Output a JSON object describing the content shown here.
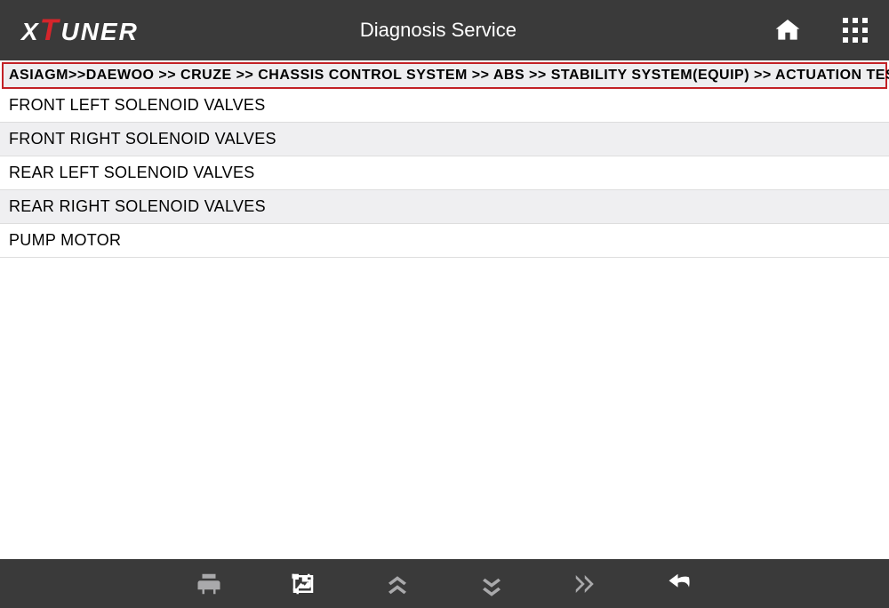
{
  "header": {
    "logo_text": "XTUNER",
    "title": "Diagnosis Service"
  },
  "breadcrumb": "ASIAGM>>DAEWOO >> CRUZE >> CHASSIS CONTROL SYSTEM >> ABS >> STABILITY SYSTEM(EQUIP) >> ACTUATION TEST",
  "list_items": [
    "FRONT LEFT SOLENOID VALVES",
    "FRONT RIGHT SOLENOID VALVES",
    "REAR LEFT SOLENOID VALVES",
    "REAR RIGHT SOLENOID VALVES",
    "PUMP MOTOR"
  ],
  "icons": {
    "home": "home-icon",
    "menu": "grid-menu-icon",
    "print": "print-icon",
    "screenshot": "screenshot-icon",
    "scroll_up": "scroll-up-icon",
    "scroll_down": "scroll-down-icon",
    "fast_forward": "fast-forward-icon",
    "back": "back-icon"
  }
}
